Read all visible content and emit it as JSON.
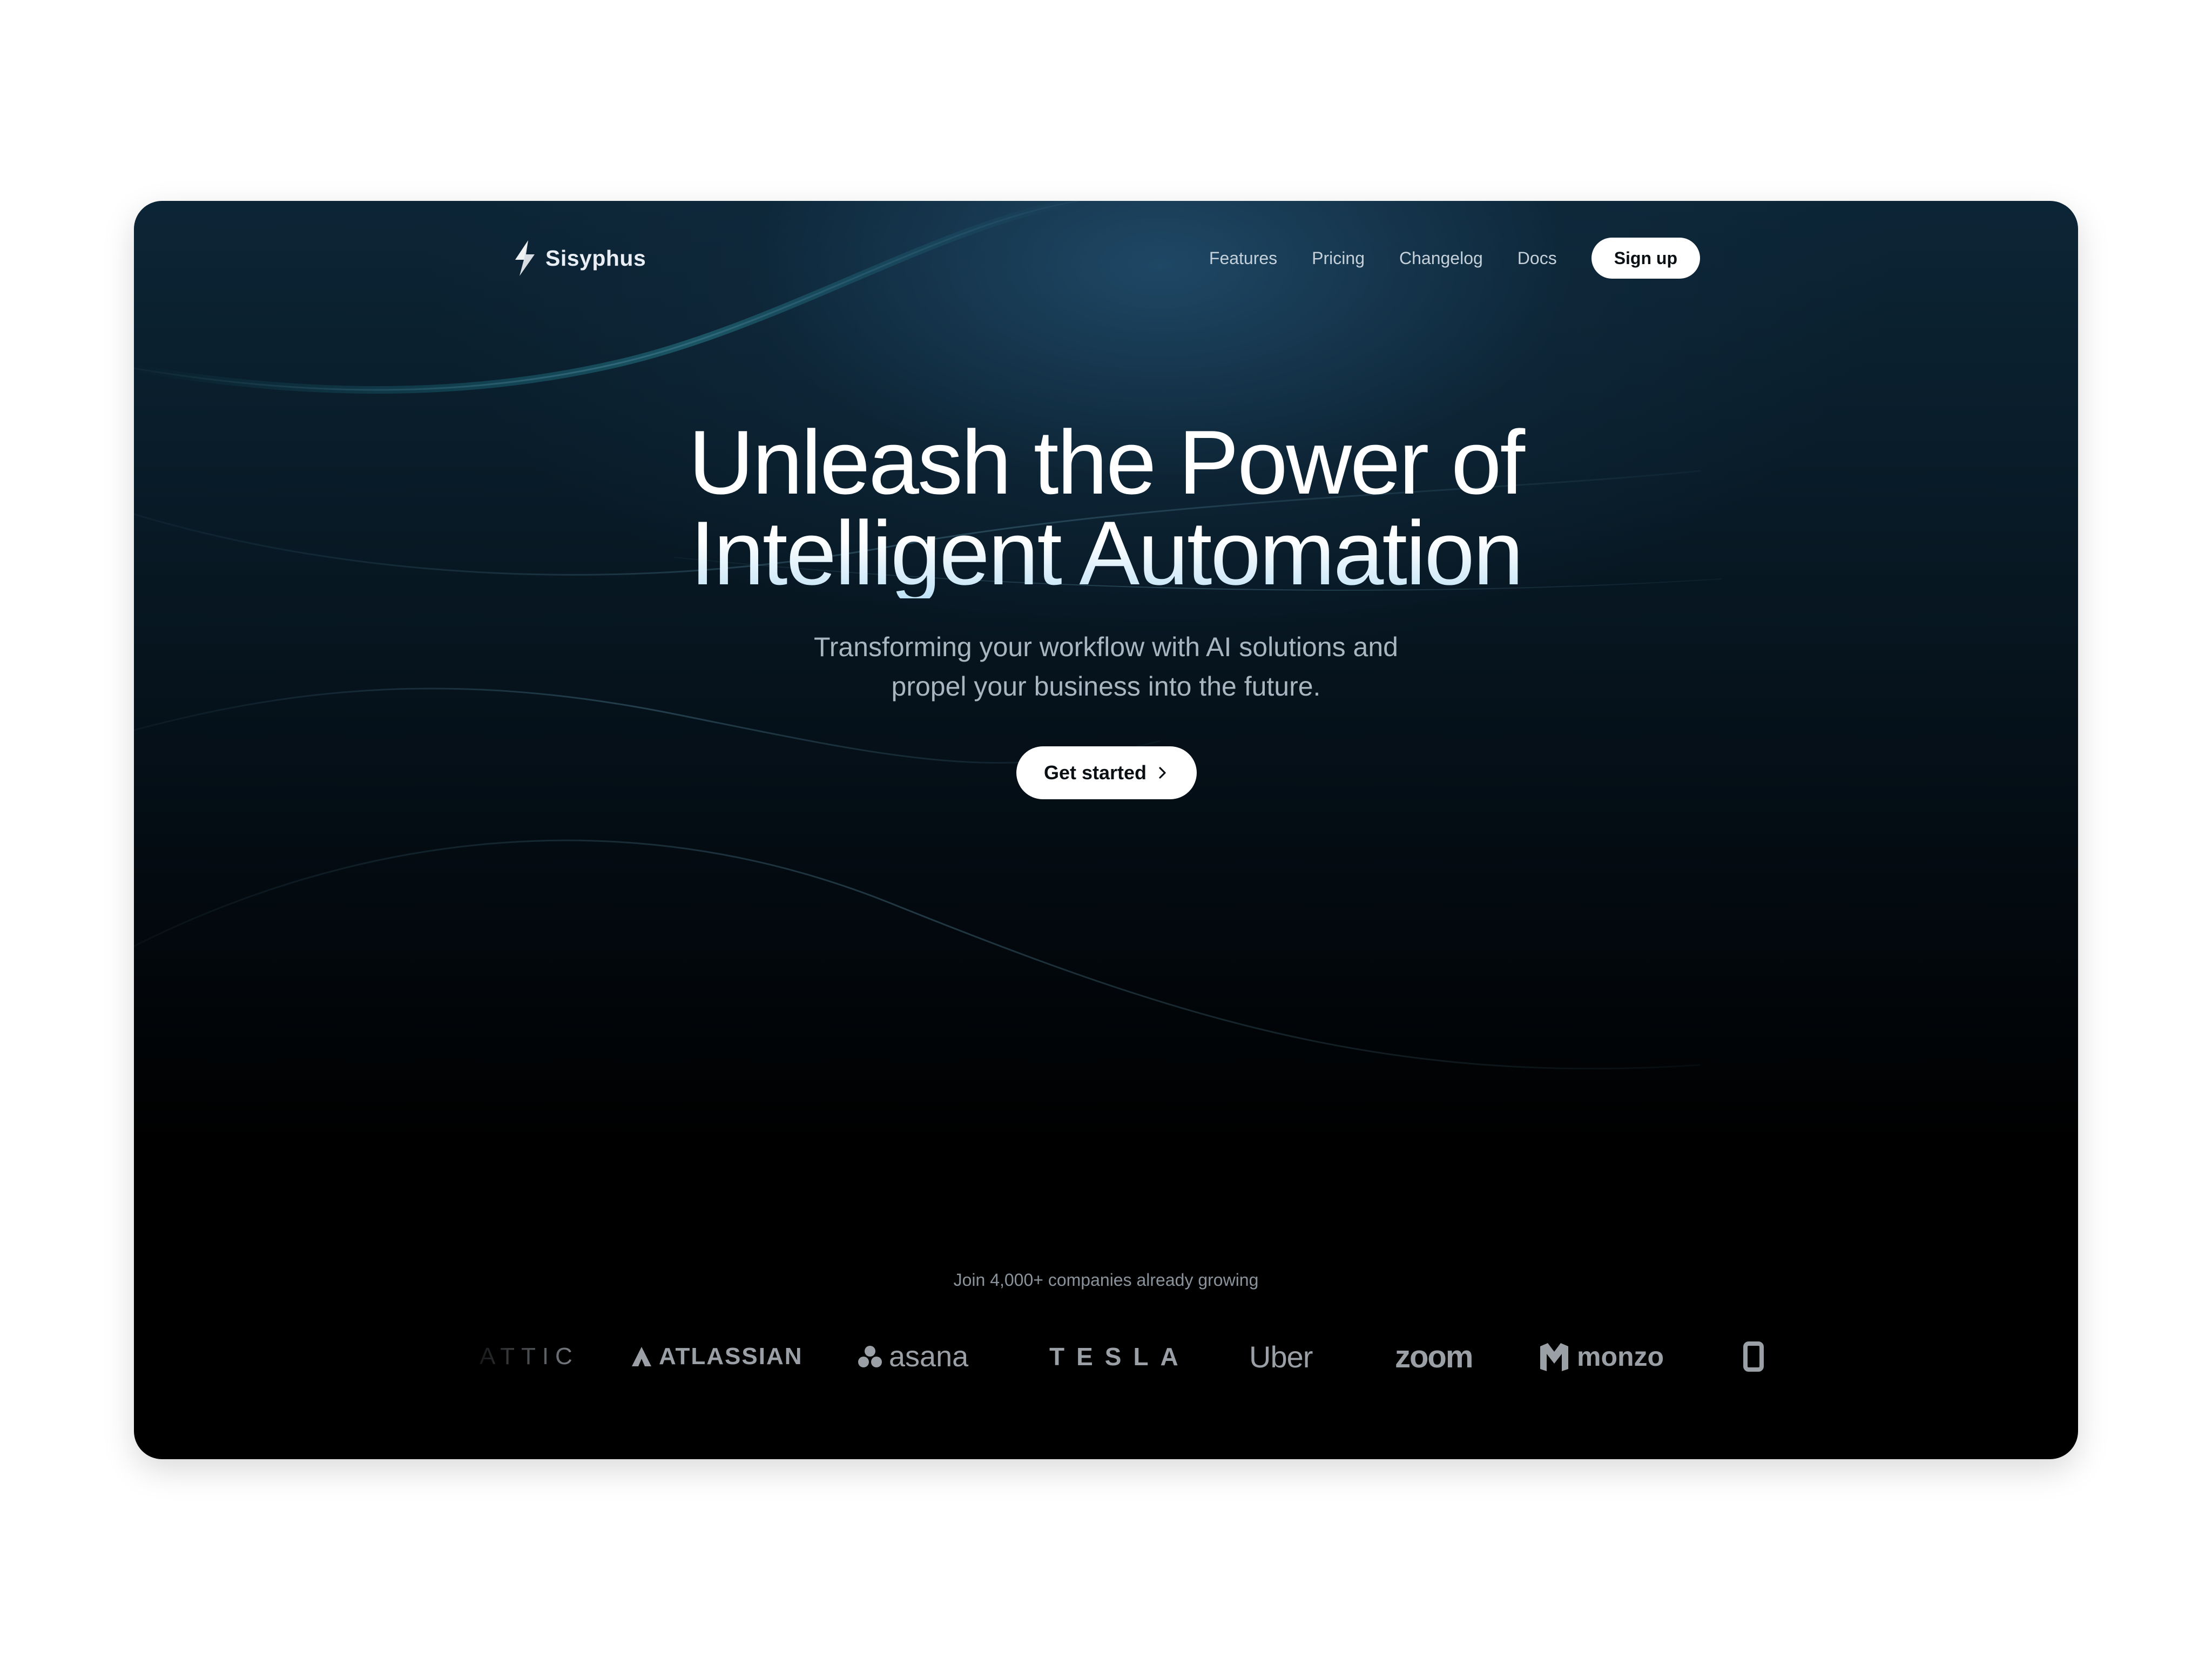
{
  "nav": {
    "brand_name": "Sisyphus",
    "links": [
      "Features",
      "Pricing",
      "Changelog",
      "Docs"
    ],
    "signup_label": "Sign up"
  },
  "hero": {
    "headline_line1": "Unleash the Power of",
    "headline_line2": "Intelligent Automation",
    "subheadline_line1": "Transforming your workflow with AI solutions and",
    "subheadline_line2": "propel your business into the future.",
    "cta_label": "Get started",
    "cta_icon": "chevron-right-icon"
  },
  "social_proof": {
    "caption": "Join 4,000+ companies already growing",
    "logos": [
      "ATTIC",
      "ATLASSIAN",
      "asana",
      "TESLA",
      "Uber",
      "zoom",
      "monzo"
    ]
  },
  "colors": {
    "background_top": "#0c2536",
    "background_bottom": "#000000",
    "button_bg": "#ffffff",
    "button_text": "#0a0f14",
    "nav_link": "#c5d1da",
    "subheadline": "#a9b6c1",
    "logo_gray": "#9aa0a6"
  }
}
